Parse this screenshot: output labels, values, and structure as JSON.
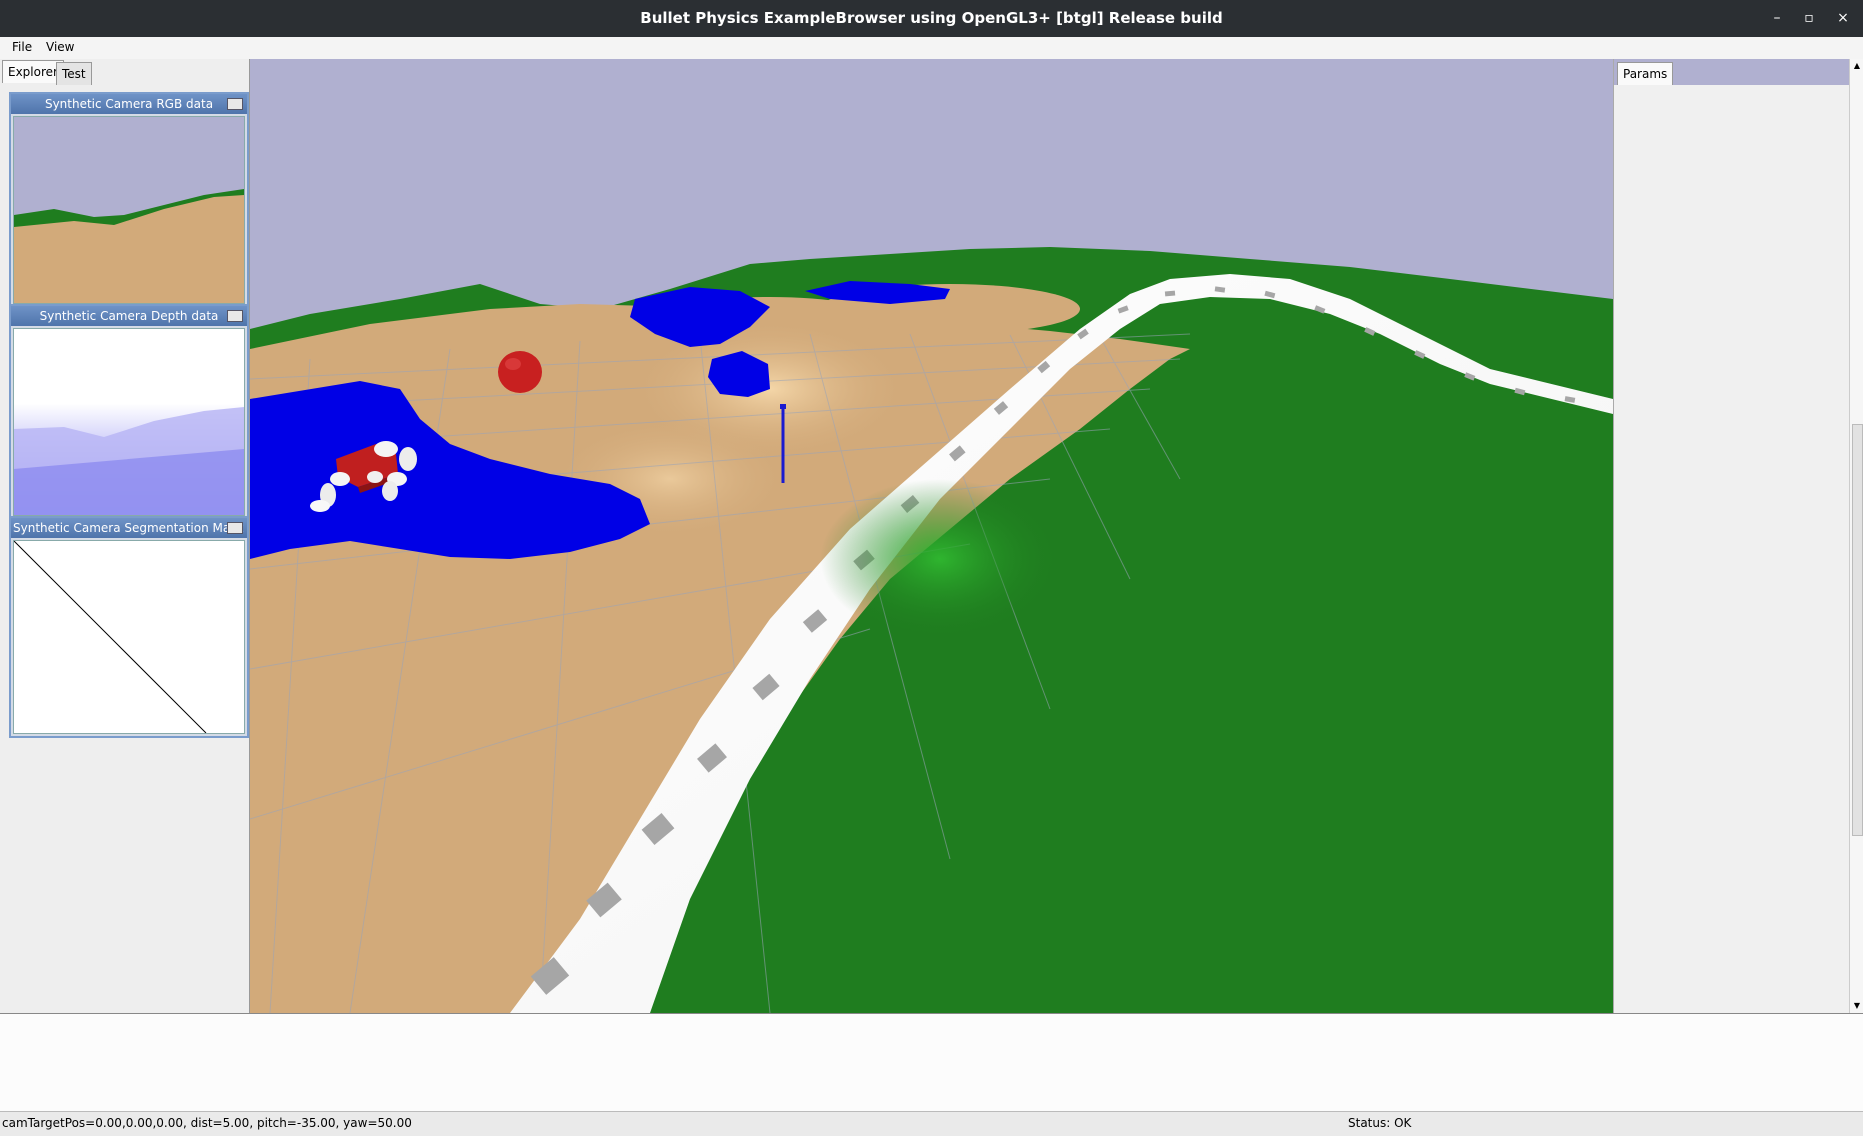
{
  "window": {
    "title": "Bullet Physics ExampleBrowser using OpenGL3+ [btgl] Release build",
    "minimize": "–",
    "maximize": "▫",
    "close": "×"
  },
  "menu": {
    "file": "File",
    "view": "View"
  },
  "left_tabs": {
    "explorer": "Explorer",
    "test": "Test"
  },
  "camera_windows": {
    "rgb": "Synthetic Camera RGB data",
    "depth": "Synthetic Camera Depth data",
    "seg": "Synthetic Camera Segmentation Mask"
  },
  "right_tabs": {
    "params": "Params"
  },
  "status": {
    "camera": "camTargetPos=0.00,0.00,0.00, dist=5.00, pitch=-35.00, yaw=50.00",
    "state": "Status: OK"
  },
  "colors": {
    "sky": "#b0b0d0",
    "sand": "#d2aa7a",
    "grass": "#1f7d1f",
    "water": "#0000e6",
    "robot_body": "#c82020",
    "accent": "#4f74ab"
  }
}
